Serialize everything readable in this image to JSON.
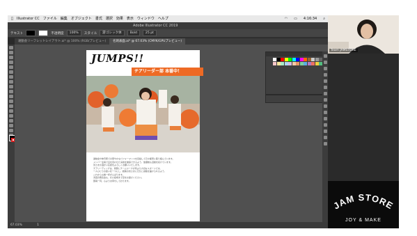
{
  "menubar": {
    "app_name": "Illustrator CC",
    "items": [
      "ファイル",
      "編集",
      "オブジェクト",
      "書式",
      "選択",
      "効果",
      "表示",
      "ウィンドウ",
      "ヘルプ"
    ],
    "clock": "4:16:34"
  },
  "app_title": "Adobe Illustrator CC 2019",
  "control_bar": {
    "text_label": "テキスト",
    "opacity_label": "不透明度",
    "opacity_value": "100%",
    "style_label": "スタイル",
    "font_name": "游ゴシック体",
    "font_style": "Bold",
    "font_size": "25 pt"
  },
  "tabs": [
    {
      "label": "運動会リーフレットレイアウト.ai* @ 100% (RGB/プレビュー)",
      "active": false
    },
    {
      "label": "名刺表面.ai* @ 67.03% (CMYK/GPUプレビュー)",
      "active": true
    }
  ],
  "artboard": {
    "headline": "JUMPS!!",
    "banner": "チアリーダー部 本番中！",
    "body_lines": [
      "運動会や体育祭での華やかなパフォーマンスを目指して日々練習に取り組んでいます。",
      "メンバー全員で息を合わせた演技を披露できるよう、放課後も活動を続けています。",
      "皆さまの温かい応援をよろしくお願いいたします。",
      "",
      "チアリーディングは、笑顔とチームワークが何より大切なスポーツです。",
      "一人ひとりの思いを一つにし、観客の皆さまに元気と感動を届けられるよう、",
      "これからも精一杯がんばります。",
      "",
      "次回の発表会も、ぜひ会場まで足をお運びください。",
      "部員一同、心よりお待ちしております。"
    ]
  },
  "webcam": {
    "name": "Team JAMSTORE"
  },
  "logo": {
    "line1": "JAM STORE",
    "line2": "JOY & MAKE"
  },
  "statusbar": {
    "zoom": "67.03%",
    "page": "1"
  },
  "colors": {
    "accent": "#ee6a24",
    "ui_bg": "#2a2a2a",
    "canvas": "#505050"
  }
}
